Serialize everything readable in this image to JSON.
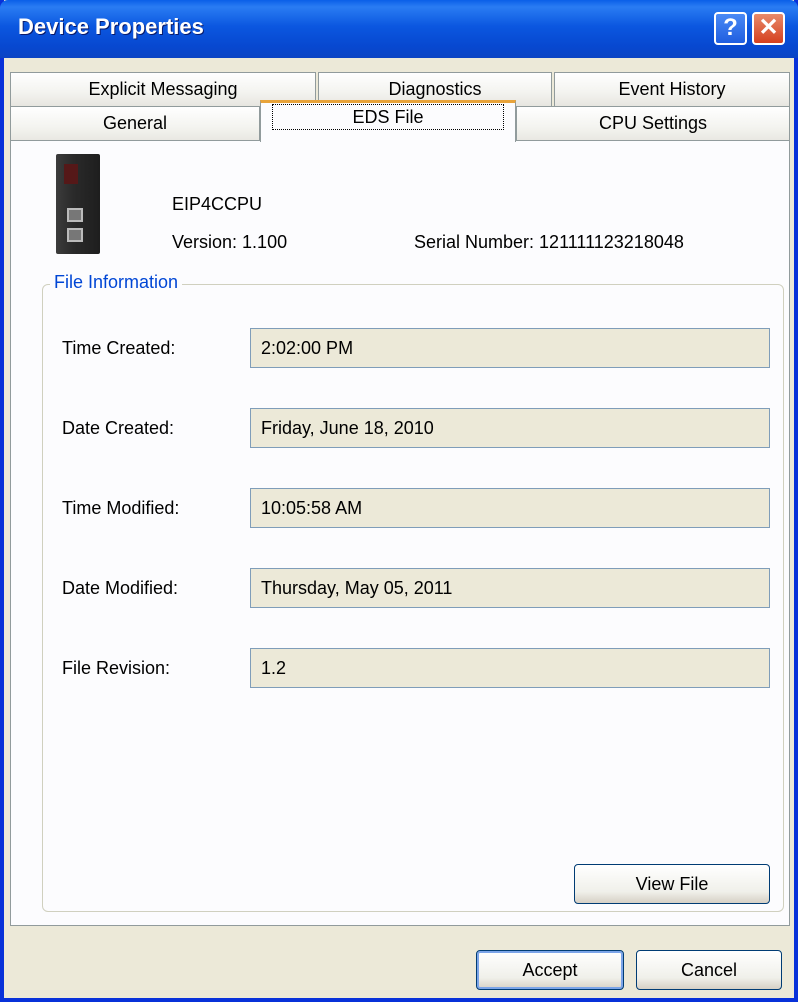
{
  "window": {
    "title": "Device Properties",
    "help_glyph": "?",
    "close_glyph": "✕"
  },
  "tabs": {
    "row1": [
      "Explicit Messaging",
      "Diagnostics",
      "Event History"
    ],
    "row2": [
      "General",
      "EDS File",
      "CPU Settings"
    ],
    "active": "EDS File"
  },
  "device": {
    "name": "EIP4CCPU",
    "version": "Version: 1.100",
    "serial": "Serial Number: 121111123218048",
    "icon": "cpu-module-icon"
  },
  "file_info": {
    "legend": "File Information",
    "fields": [
      {
        "label": "Time Created:",
        "value": "2:02:00 PM"
      },
      {
        "label": "Date Created:",
        "value": "Friday, June 18, 2010"
      },
      {
        "label": "Time Modified:",
        "value": "10:05:58 AM"
      },
      {
        "label": "Date Modified:",
        "value": "Thursday, May 05, 2011"
      },
      {
        "label": "File Revision:",
        "value": "1.2"
      }
    ],
    "view_file_label": "View File"
  },
  "footer": {
    "accept_label": "Accept",
    "cancel_label": "Cancel"
  },
  "colors": {
    "titlebar": "#0b57e0",
    "tab_highlight": "#e8a33a",
    "legend_text": "#0046d5",
    "readonly_field": "#ece9d8"
  }
}
